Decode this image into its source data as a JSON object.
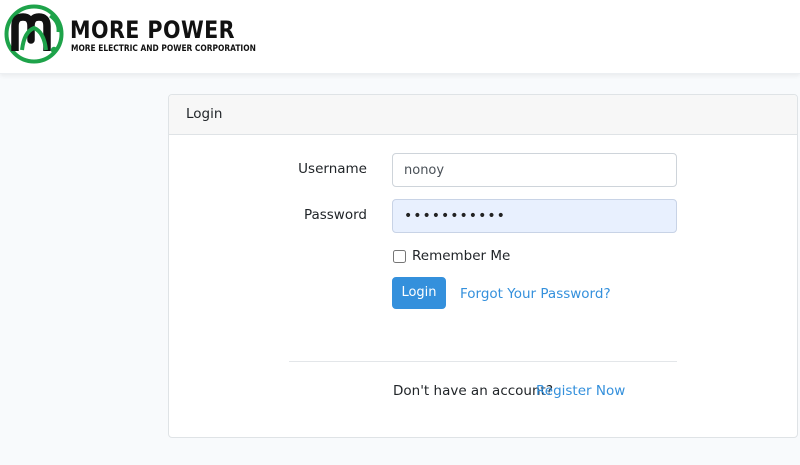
{
  "brand": {
    "title": "MORE POWER",
    "subtitle": "MORE ELECTRIC AND POWER CORPORATION",
    "logo_icon": "more-power-logo",
    "colors": {
      "green": "#1ea34a",
      "dark": "#111111"
    }
  },
  "card": {
    "header": "Login",
    "username": {
      "label": "Username",
      "value": "nonoy"
    },
    "password": {
      "label": "Password",
      "value": "•••••••••••"
    },
    "remember": {
      "label": "Remember Me",
      "checked": false
    },
    "login_button": "Login",
    "forgot_link": "Forgot Your Password?",
    "no_account_text": "Don't have an account?",
    "register_link": "Register Now"
  },
  "colors": {
    "primary": "#3490dc",
    "autofill_bg": "#e8f0fe"
  }
}
